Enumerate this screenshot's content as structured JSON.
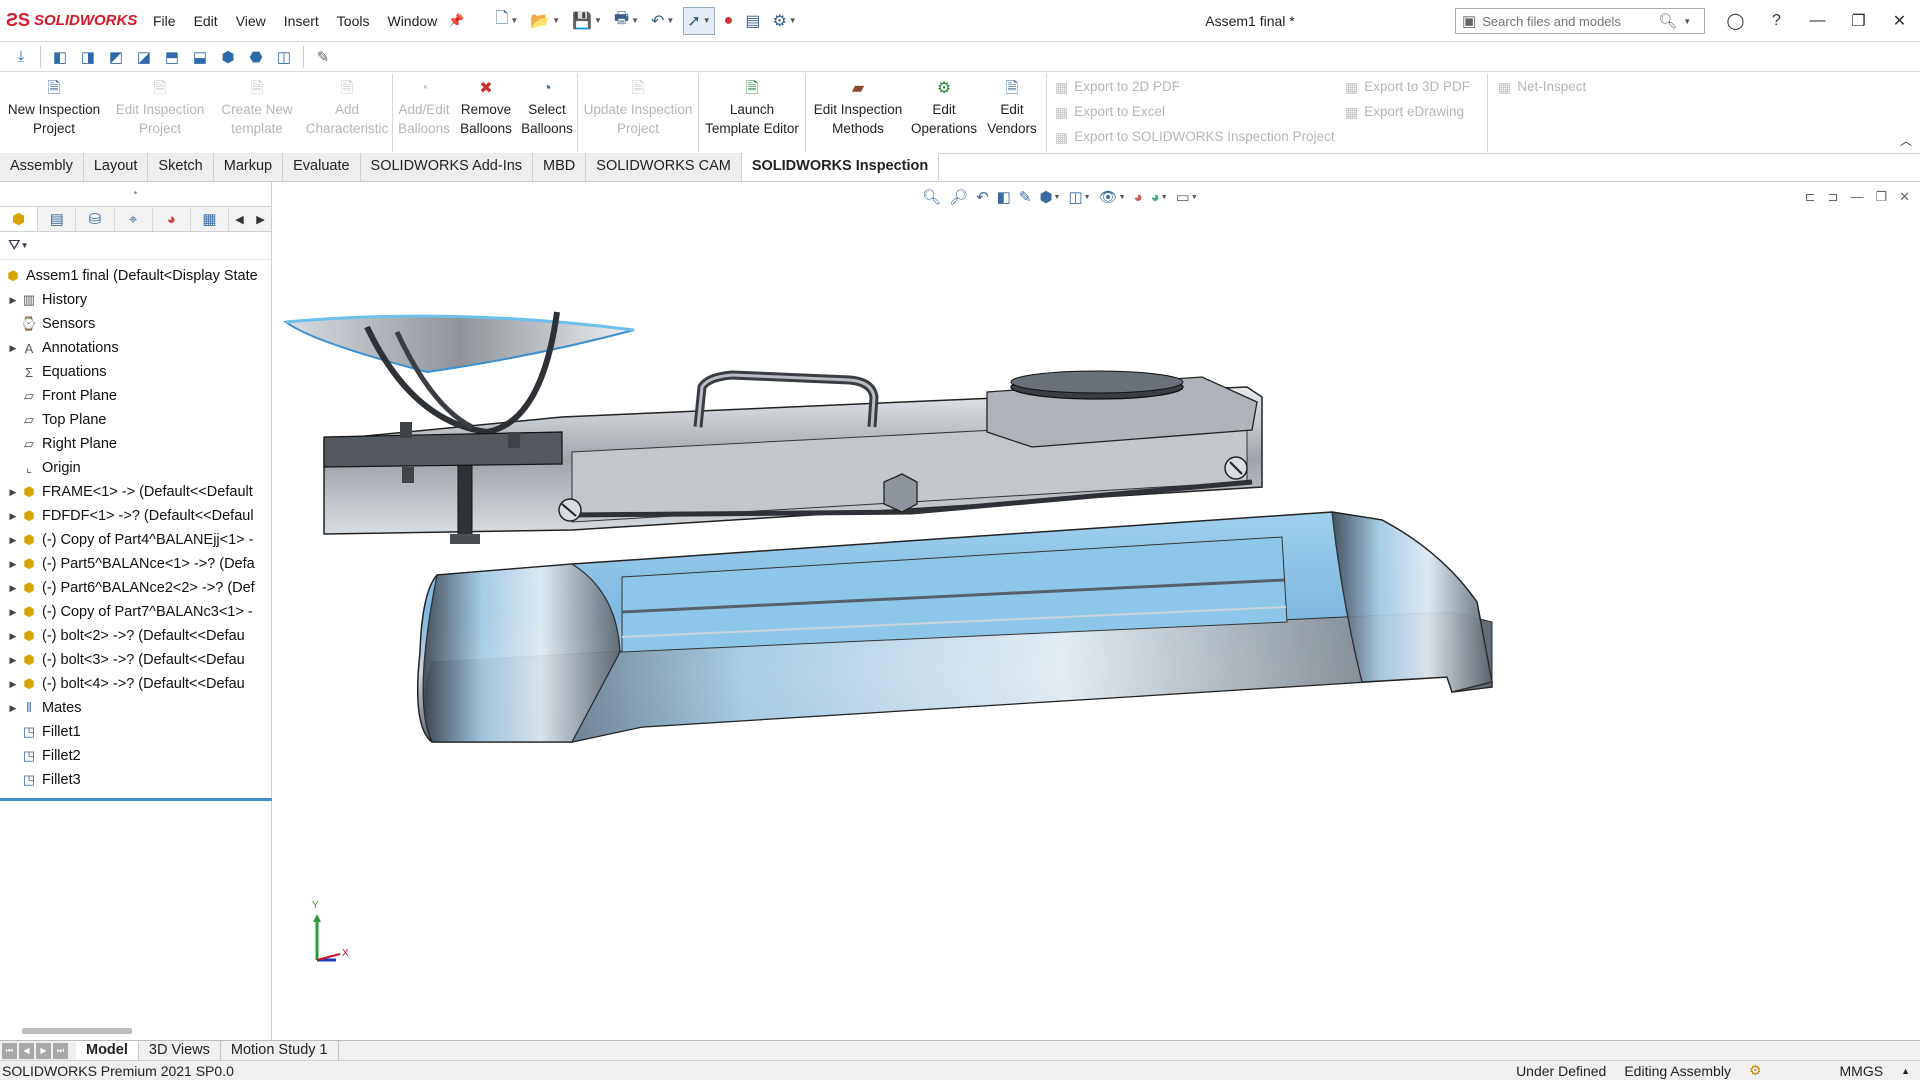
{
  "app": {
    "name": "SOLIDWORKS",
    "doc_title": "Assem1 final *"
  },
  "menu": [
    "File",
    "Edit",
    "View",
    "Insert",
    "Tools",
    "Window"
  ],
  "search": {
    "placeholder": "Search files and models"
  },
  "ribbon": {
    "buttons": [
      {
        "label": "New Inspection Project",
        "line1": "New Inspection",
        "line2": "Project",
        "enabled": true
      },
      {
        "label": "Edit Inspection Project",
        "line1": "Edit Inspection",
        "line2": "Project",
        "enabled": false
      },
      {
        "label": "Create New template",
        "line1": "Create New",
        "line2": "template",
        "enabled": false
      },
      {
        "label": "Add Characteristic",
        "line1": "Add",
        "line2": "Characteristic",
        "enabled": false
      },
      {
        "label": "Add/Edit Balloons",
        "line1": "Add/Edit",
        "line2": "Balloons",
        "enabled": false
      },
      {
        "label": "Remove Balloons",
        "line1": "Remove",
        "line2": "Balloons",
        "enabled": true
      },
      {
        "label": "Select Balloons",
        "line1": "Select",
        "line2": "Balloons",
        "enabled": true
      },
      {
        "label": "Update Inspection Project",
        "line1": "Update Inspection",
        "line2": "Project",
        "enabled": false
      },
      {
        "label": "Launch Template Editor",
        "line1": "Launch",
        "line2": "Template Editor",
        "enabled": true
      },
      {
        "label": "Edit Inspection Methods",
        "line1": "Edit Inspection",
        "line2": "Methods",
        "enabled": true
      },
      {
        "label": "Edit Operations",
        "line1": "Edit",
        "line2": "Operations",
        "enabled": true
      },
      {
        "label": "Edit Vendors",
        "line1": "Edit",
        "line2": "Vendors",
        "enabled": true
      }
    ],
    "export_left": [
      "Export to 2D PDF",
      "Export to Excel",
      "Export to SOLIDWORKS Inspection Project"
    ],
    "export_right": [
      "Export to 3D PDF",
      "Export eDrawing"
    ],
    "net_inspect": "Net-Inspect"
  },
  "tabs": [
    "Assembly",
    "Layout",
    "Sketch",
    "Markup",
    "Evaluate",
    "SOLIDWORKS Add-Ins",
    "MBD",
    "SOLIDWORKS CAM",
    "SOLIDWORKS Inspection"
  ],
  "active_tab": "SOLIDWORKS Inspection",
  "tree": {
    "root": "Assem1 final  (Default<Display State",
    "items": [
      {
        "label": "History",
        "icon": "history-icon",
        "expandable": true
      },
      {
        "label": "Sensors",
        "icon": "sensors-icon",
        "expandable": false
      },
      {
        "label": "Annotations",
        "icon": "annotations-icon",
        "expandable": true
      },
      {
        "label": "Equations",
        "icon": "equations-icon",
        "expandable": false
      },
      {
        "label": "Front Plane",
        "icon": "plane-icon",
        "expandable": false
      },
      {
        "label": "Top Plane",
        "icon": "plane-icon",
        "expandable": false
      },
      {
        "label": "Right Plane",
        "icon": "plane-icon",
        "expandable": false
      },
      {
        "label": "Origin",
        "icon": "origin-icon",
        "expandable": false
      },
      {
        "label": "FRAME<1> -> (Default<<Default",
        "icon": "part-icon",
        "expandable": true
      },
      {
        "label": "FDFDF<1> ->? (Default<<Defaul",
        "icon": "part-icon",
        "expandable": true
      },
      {
        "label": "(-) Copy of Part4^BALANEjj<1> -",
        "icon": "part-icon",
        "expandable": true
      },
      {
        "label": "(-) Part5^BALANce<1> ->? (Defa",
        "icon": "part-icon",
        "expandable": true
      },
      {
        "label": "(-) Part6^BALANce2<2> ->? (Def",
        "icon": "part-icon",
        "expandable": true
      },
      {
        "label": "(-) Copy of Part7^BALANc3<1> -",
        "icon": "part-icon",
        "expandable": true
      },
      {
        "label": "(-) bolt<2> ->? (Default<<Defau",
        "icon": "part-icon",
        "expandable": true
      },
      {
        "label": "(-) bolt<3> ->? (Default<<Defau",
        "icon": "part-icon",
        "expandable": true
      },
      {
        "label": "(-) bolt<4> ->? (Default<<Defau",
        "icon": "part-icon",
        "expandable": true
      },
      {
        "label": "Mates",
        "icon": "mates-icon",
        "expandable": true
      },
      {
        "label": "Fillet1",
        "icon": "fillet-icon",
        "expandable": false
      },
      {
        "label": "Fillet2",
        "icon": "fillet-icon",
        "expandable": false
      },
      {
        "label": "Fillet3",
        "icon": "fillet-icon",
        "expandable": false
      }
    ]
  },
  "triad": {
    "y": "Y",
    "x": "X"
  },
  "bottom_tabs": [
    "Model",
    "3D Views",
    "Motion Study 1"
  ],
  "active_bottom_tab": "Model",
  "status": {
    "left": "SOLIDWORKS Premium 2021 SP0.0",
    "state": "Under Defined",
    "mode": "Editing Assembly",
    "units": "MMGS"
  },
  "colors": {
    "accent": "#3e8ed0",
    "brand": "#d7192a",
    "model_blue": "#8fc3e6",
    "model_steel": "#b8bcc2"
  }
}
